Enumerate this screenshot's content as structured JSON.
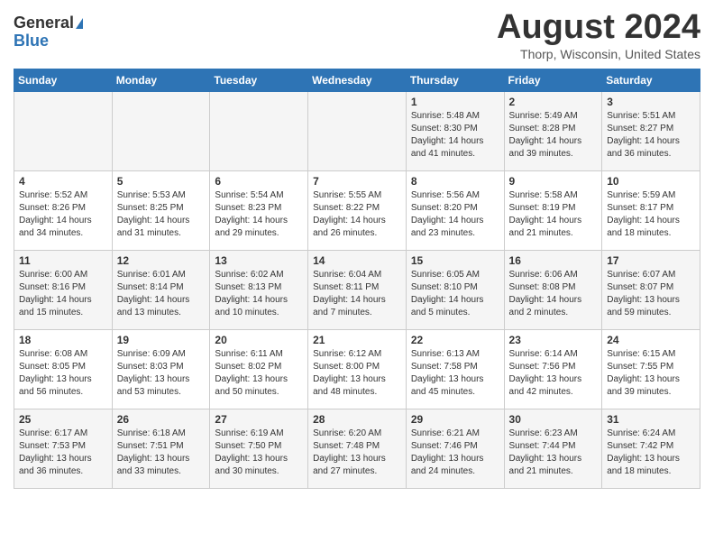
{
  "header": {
    "logo_general": "General",
    "logo_blue": "Blue",
    "month": "August 2024",
    "location": "Thorp, Wisconsin, United States"
  },
  "weekdays": [
    "Sunday",
    "Monday",
    "Tuesday",
    "Wednesday",
    "Thursday",
    "Friday",
    "Saturday"
  ],
  "rows": [
    [
      {
        "date": "",
        "content": ""
      },
      {
        "date": "",
        "content": ""
      },
      {
        "date": "",
        "content": ""
      },
      {
        "date": "",
        "content": ""
      },
      {
        "date": "1",
        "content": "Sunrise: 5:48 AM\nSunset: 8:30 PM\nDaylight: 14 hours\nand 41 minutes."
      },
      {
        "date": "2",
        "content": "Sunrise: 5:49 AM\nSunset: 8:28 PM\nDaylight: 14 hours\nand 39 minutes."
      },
      {
        "date": "3",
        "content": "Sunrise: 5:51 AM\nSunset: 8:27 PM\nDaylight: 14 hours\nand 36 minutes."
      }
    ],
    [
      {
        "date": "4",
        "content": "Sunrise: 5:52 AM\nSunset: 8:26 PM\nDaylight: 14 hours\nand 34 minutes."
      },
      {
        "date": "5",
        "content": "Sunrise: 5:53 AM\nSunset: 8:25 PM\nDaylight: 14 hours\nand 31 minutes."
      },
      {
        "date": "6",
        "content": "Sunrise: 5:54 AM\nSunset: 8:23 PM\nDaylight: 14 hours\nand 29 minutes."
      },
      {
        "date": "7",
        "content": "Sunrise: 5:55 AM\nSunset: 8:22 PM\nDaylight: 14 hours\nand 26 minutes."
      },
      {
        "date": "8",
        "content": "Sunrise: 5:56 AM\nSunset: 8:20 PM\nDaylight: 14 hours\nand 23 minutes."
      },
      {
        "date": "9",
        "content": "Sunrise: 5:58 AM\nSunset: 8:19 PM\nDaylight: 14 hours\nand 21 minutes."
      },
      {
        "date": "10",
        "content": "Sunrise: 5:59 AM\nSunset: 8:17 PM\nDaylight: 14 hours\nand 18 minutes."
      }
    ],
    [
      {
        "date": "11",
        "content": "Sunrise: 6:00 AM\nSunset: 8:16 PM\nDaylight: 14 hours\nand 15 minutes."
      },
      {
        "date": "12",
        "content": "Sunrise: 6:01 AM\nSunset: 8:14 PM\nDaylight: 14 hours\nand 13 minutes."
      },
      {
        "date": "13",
        "content": "Sunrise: 6:02 AM\nSunset: 8:13 PM\nDaylight: 14 hours\nand 10 minutes."
      },
      {
        "date": "14",
        "content": "Sunrise: 6:04 AM\nSunset: 8:11 PM\nDaylight: 14 hours\nand 7 minutes."
      },
      {
        "date": "15",
        "content": "Sunrise: 6:05 AM\nSunset: 8:10 PM\nDaylight: 14 hours\nand 5 minutes."
      },
      {
        "date": "16",
        "content": "Sunrise: 6:06 AM\nSunset: 8:08 PM\nDaylight: 14 hours\nand 2 minutes."
      },
      {
        "date": "17",
        "content": "Sunrise: 6:07 AM\nSunset: 8:07 PM\nDaylight: 13 hours\nand 59 minutes."
      }
    ],
    [
      {
        "date": "18",
        "content": "Sunrise: 6:08 AM\nSunset: 8:05 PM\nDaylight: 13 hours\nand 56 minutes."
      },
      {
        "date": "19",
        "content": "Sunrise: 6:09 AM\nSunset: 8:03 PM\nDaylight: 13 hours\nand 53 minutes."
      },
      {
        "date": "20",
        "content": "Sunrise: 6:11 AM\nSunset: 8:02 PM\nDaylight: 13 hours\nand 50 minutes."
      },
      {
        "date": "21",
        "content": "Sunrise: 6:12 AM\nSunset: 8:00 PM\nDaylight: 13 hours\nand 48 minutes."
      },
      {
        "date": "22",
        "content": "Sunrise: 6:13 AM\nSunset: 7:58 PM\nDaylight: 13 hours\nand 45 minutes."
      },
      {
        "date": "23",
        "content": "Sunrise: 6:14 AM\nSunset: 7:56 PM\nDaylight: 13 hours\nand 42 minutes."
      },
      {
        "date": "24",
        "content": "Sunrise: 6:15 AM\nSunset: 7:55 PM\nDaylight: 13 hours\nand 39 minutes."
      }
    ],
    [
      {
        "date": "25",
        "content": "Sunrise: 6:17 AM\nSunset: 7:53 PM\nDaylight: 13 hours\nand 36 minutes."
      },
      {
        "date": "26",
        "content": "Sunrise: 6:18 AM\nSunset: 7:51 PM\nDaylight: 13 hours\nand 33 minutes."
      },
      {
        "date": "27",
        "content": "Sunrise: 6:19 AM\nSunset: 7:50 PM\nDaylight: 13 hours\nand 30 minutes."
      },
      {
        "date": "28",
        "content": "Sunrise: 6:20 AM\nSunset: 7:48 PM\nDaylight: 13 hours\nand 27 minutes."
      },
      {
        "date": "29",
        "content": "Sunrise: 6:21 AM\nSunset: 7:46 PM\nDaylight: 13 hours\nand 24 minutes."
      },
      {
        "date": "30",
        "content": "Sunrise: 6:23 AM\nSunset: 7:44 PM\nDaylight: 13 hours\nand 21 minutes."
      },
      {
        "date": "31",
        "content": "Sunrise: 6:24 AM\nSunset: 7:42 PM\nDaylight: 13 hours\nand 18 minutes."
      }
    ]
  ]
}
